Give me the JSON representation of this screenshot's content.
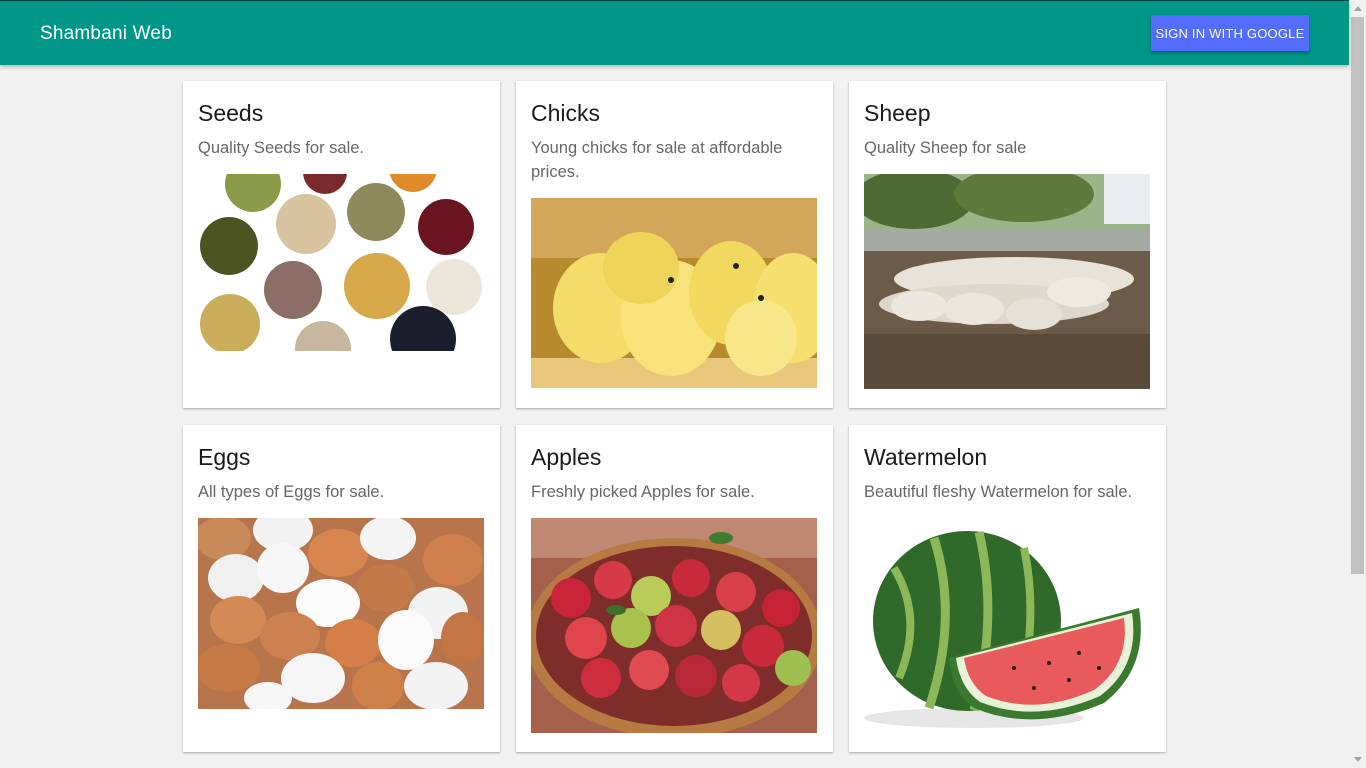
{
  "header": {
    "title": "Shambani Web",
    "signin_label": "SIGN IN WITH GOOGLE",
    "bar_color": "#009688",
    "button_color": "#536dfe"
  },
  "products": [
    {
      "title": "Seeds",
      "description": "Quality Seeds for sale.",
      "image": "seeds-image"
    },
    {
      "title": "Chicks",
      "description": "Young chicks for sale at affordable prices.",
      "image": "chicks-image"
    },
    {
      "title": "Sheep",
      "description": "Quality Sheep for sale",
      "image": "sheep-image"
    },
    {
      "title": "Eggs",
      "description": "All types of Eggs for sale.",
      "image": "eggs-image"
    },
    {
      "title": "Apples",
      "description": "Freshly picked Apples for sale.",
      "image": "apples-image"
    },
    {
      "title": "Watermelon",
      "description": "Beautiful fleshy Watermelon for sale.",
      "image": "watermelon-image"
    }
  ]
}
